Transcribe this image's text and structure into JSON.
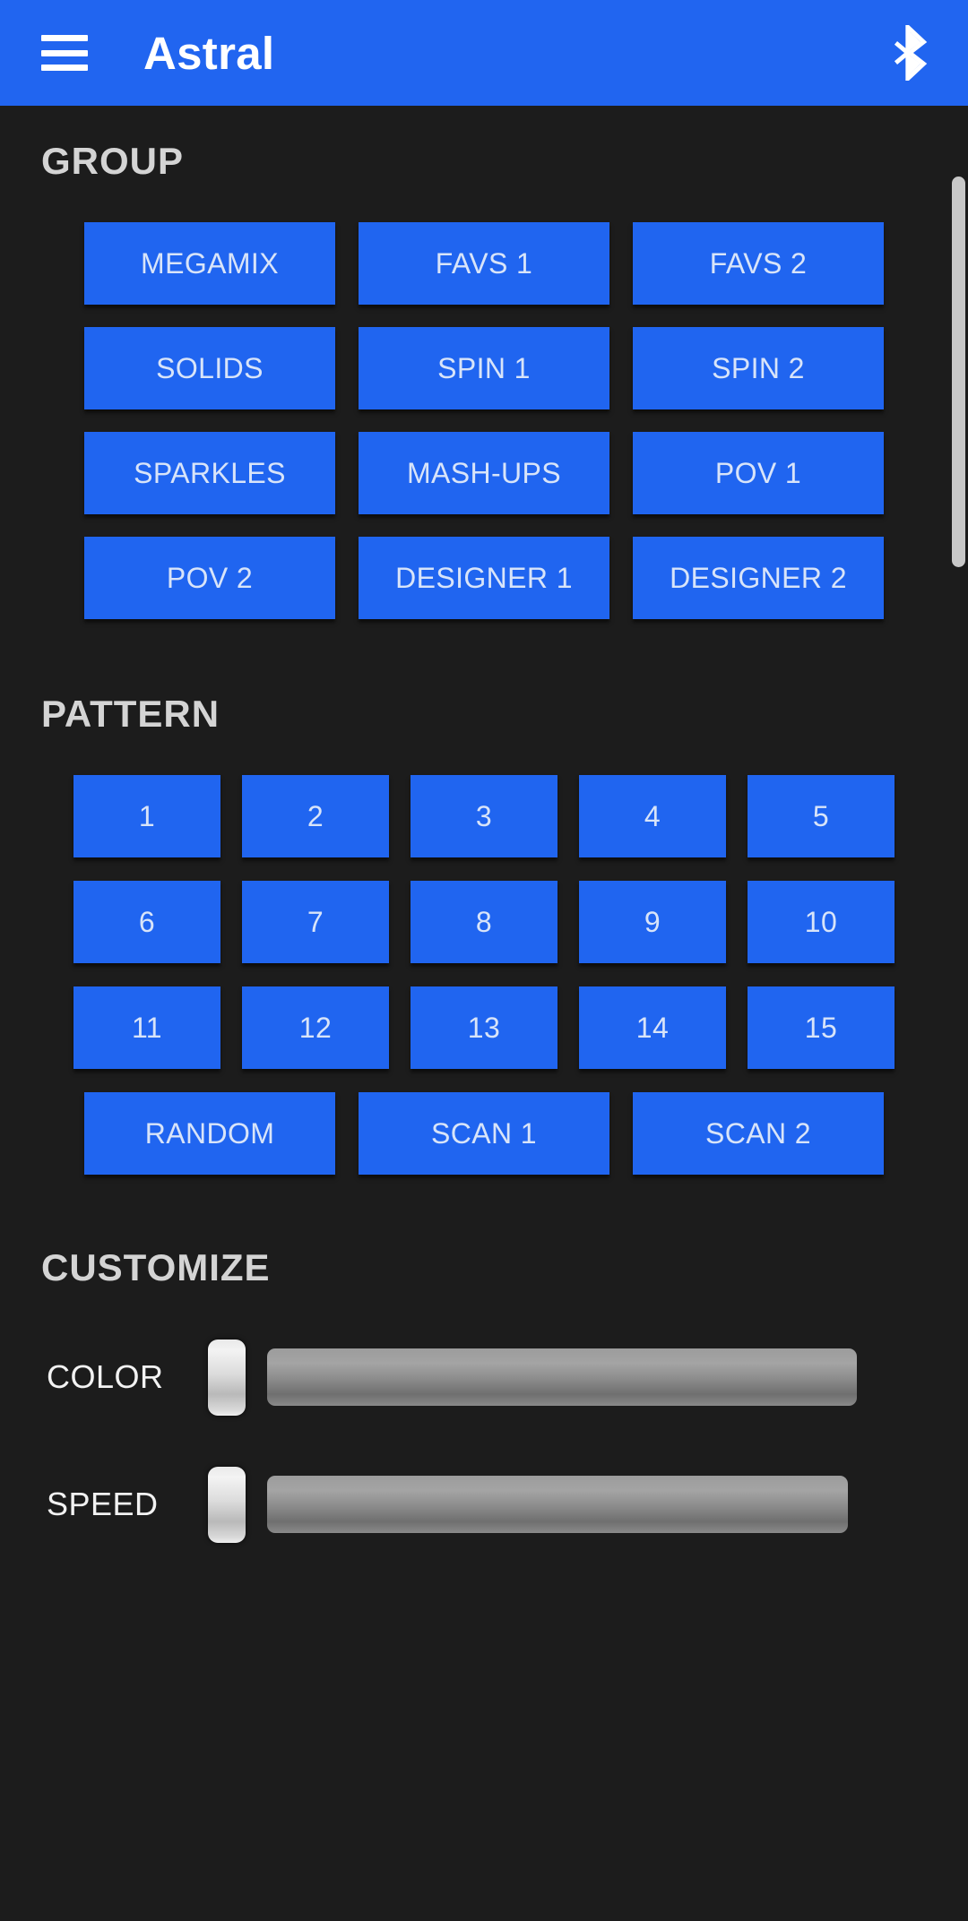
{
  "appbar": {
    "title": "Astral",
    "menu_icon": "hamburger-menu-icon",
    "bluetooth_icon": "bluetooth-icon",
    "background_color": "#2165f0"
  },
  "theme": {
    "background_color": "#1c1c1c",
    "button_color": "#2065f0",
    "button_text_color": "#d8e4f9",
    "section_title_color": "#d4d4d4",
    "slider_label_color": "#f2f2f2",
    "scrollbar_color": "#c8c8c8"
  },
  "sections": {
    "group": {
      "title": "GROUP",
      "buttons": [
        "MEGAMIX",
        "FAVS 1",
        "FAVS 2",
        "SOLIDS",
        "SPIN 1",
        "SPIN 2",
        "SPARKLES",
        "MASH-UPS",
        "POV 1",
        "POV 2",
        "DESIGNER 1",
        "DESIGNER 2"
      ]
    },
    "pattern": {
      "title": "PATTERN",
      "numbered_buttons": [
        "1",
        "2",
        "3",
        "4",
        "5",
        "6",
        "7",
        "8",
        "9",
        "10",
        "11",
        "12",
        "13",
        "14",
        "15"
      ],
      "wide_buttons": [
        "RANDOM",
        "SCAN 1",
        "SCAN 2"
      ]
    },
    "customize": {
      "title": "CUSTOMIZE",
      "sliders": [
        {
          "label": "COLOR",
          "value": 0
        },
        {
          "label": "SPEED",
          "value": 0
        }
      ]
    }
  }
}
